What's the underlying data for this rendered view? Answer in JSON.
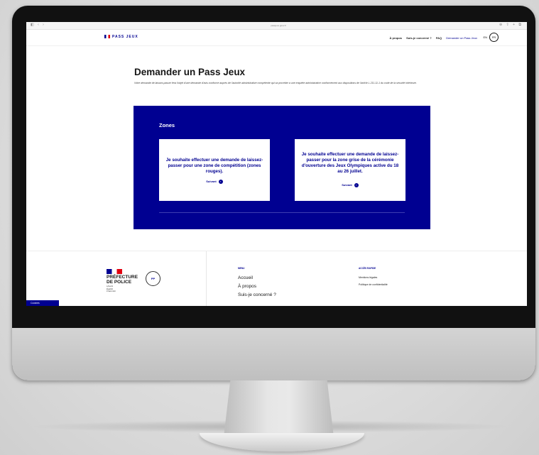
{
  "browser": {
    "url": "passjeux.gouv.fr"
  },
  "header": {
    "logo": "PASS JEUX",
    "nav": [
      "À propos",
      "Suis-je concerné ?",
      "FAQ"
    ],
    "nav_active": "Demander un Pass Jeux",
    "lang_en": "EN",
    "lang_fr": "FR"
  },
  "main": {
    "title": "Demander un Pass Jeux",
    "intro": "Votre demande de laissez-passer fera l'objet d'une demande d'avis conforme auprès de l'autorité administrative compétente qui va procéder à une enquête administrative conformément aux dispositions de l'article L.211-11-1 du code de la sécurité intérieure.",
    "zones_title": "Zones",
    "cards": [
      {
        "text": "Je souhaite effectuer une demande de laissez-passer pour une zone de compétition (zones rouges).",
        "next": "Suivant"
      },
      {
        "text": "Je souhaite effectuer une demande de laissez-passer pour la zone grise de la cérémonie d'ouverture des Jeux Olympiques active du 18 au 26 juillet.",
        "next": "Suivant"
      }
    ]
  },
  "footer": {
    "prefecture": "PRÉFECTURE\nDE POLICE",
    "motto": "Liberté\nÉgalité\nFraternité",
    "badge": "PP",
    "menu_heading": "MENU",
    "menu": [
      "Accueil",
      "À propos",
      "Suis-je concerné ?"
    ],
    "quick_heading": "ACCÈS RAPIDE",
    "quick": [
      "Mentions légales",
      "Politique de confidentialité"
    ],
    "cookies": "Cookies"
  },
  "colors": {
    "brand_blue": "#000091",
    "brand_red": "#e1000f"
  }
}
